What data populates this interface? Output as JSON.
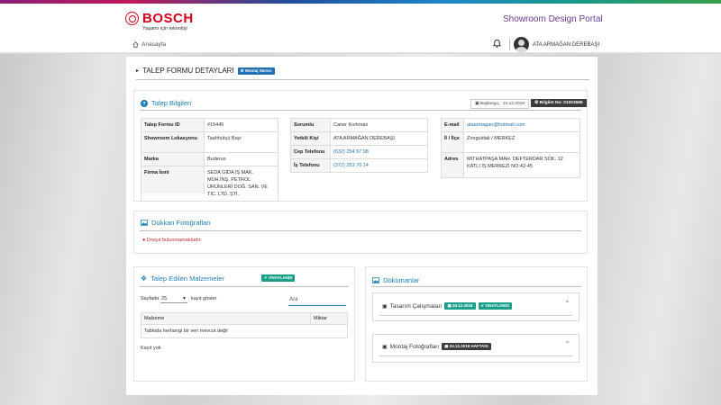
{
  "brand": {
    "name": "BOSCH",
    "tagline": "Yaşamı için teknoloji"
  },
  "header": {
    "portal_title": "Showroom Design Portal",
    "username": "ATA ARMAĞAN DEREBAŞI"
  },
  "breadcrumb": {
    "home": "Anasayfa"
  },
  "page": {
    "title": "TALEP FORMU DETAYLARI",
    "status_badge": "Montaj Süreci"
  },
  "talep": {
    "title": "Talep Bilgileri",
    "date_chip": "Başlangıç : 24.12.2018",
    "number_chip": "Bilgilet No: 01003586",
    "col1": [
      {
        "label": "Talep Formu ID",
        "value": "#15445"
      },
      {
        "label": "Showroom Lokasyonu",
        "value": "Taahhütçü Bayi"
      },
      {
        "label": "Marka",
        "value": "Buderus"
      },
      {
        "label": "Firma İsmi",
        "value": "SEDA GIDA İŞ MAK. MÜH.İNŞ. PETROL ÜRÜNLERİ DOĞ. SAN. VE TİC. LTD. ŞTİ."
      }
    ],
    "col2": [
      {
        "label": "Sorumlu",
        "value": "Caner Korkmaz"
      },
      {
        "label": "Yetkili Kişi",
        "value": "ATA ARMAĞAN DEREBAŞI"
      },
      {
        "label": "Cep Telefonu",
        "value": "(532) 254 97 08"
      },
      {
        "label": "İş Telefonu",
        "value": "(372) 253 70 14"
      }
    ],
    "col3": [
      {
        "label": "E-mail",
        "value": "ataarmagan@hotmail.com"
      },
      {
        "label": "İl / İlçe",
        "value": "Zonguldak / MERKEZ"
      },
      {
        "label": "Adres",
        "value": "MITHATPAŞA MAH. DEFTERDAR SOK. 12 KATLI İŞ MERKEZİ NO:42-45"
      }
    ]
  },
  "photos": {
    "title": "Dükkan Fotoğrafları",
    "empty": "Dosya bulunmamaktadır."
  },
  "materials": {
    "title": "Talep Edilen Malzemeler",
    "badge": "ONAYLANDI",
    "page_size_prefix": "Sayfada",
    "page_size_value": "25",
    "page_size_suffix": "kayıt göster",
    "search_placeholder": "Ara",
    "columns": [
      "Malzeme",
      "Miktar"
    ],
    "empty": "Tabloda herhangi bir veri mevcut değil",
    "footer": "Kayıt yok"
  },
  "documents": {
    "title": "Dökümanlar",
    "items": [
      {
        "title": "Tasarım Çalışmaları",
        "date": "26.12.2018",
        "status": "ONAYLANDI"
      },
      {
        "title": "Montaj Fotoğrafları",
        "date": "24.12.2018 HAFTASI"
      }
    ]
  }
}
